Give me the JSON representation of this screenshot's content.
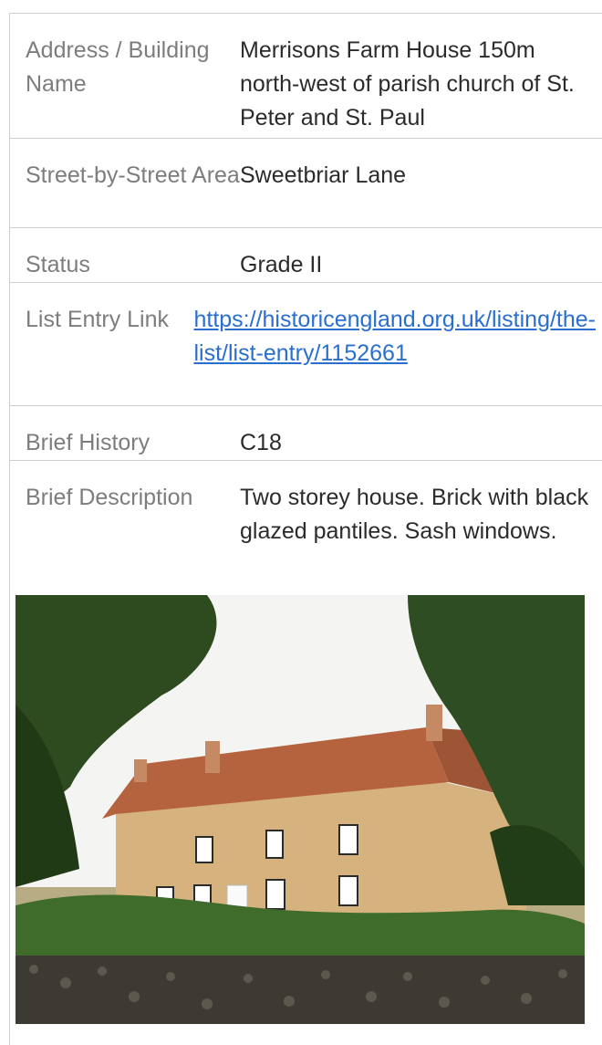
{
  "table": {
    "rows": [
      {
        "label": "Address / Building Name",
        "value": "Merrisons Farm House 150m north-west of parish church of St. Peter and St. Paul"
      },
      {
        "label": "Street-by-Street Area",
        "value": "Sweetbriar Lane"
      },
      {
        "label": "Status",
        "value": "Grade II"
      },
      {
        "label": "List Entry Link",
        "value": "https://historicengland.org.uk/listing/the-list/list-entry/1152661"
      },
      {
        "label": "Brief History",
        "value": "C18"
      },
      {
        "label": "Brief Description",
        "value": "Two storey house. Brick with black glazed pantiles. Sash windows."
      }
    ]
  },
  "photo": {
    "subject": "photo-farmhouse",
    "colors": {
      "sky": "#f4f4f2",
      "roof": "#b5633f",
      "wall": "#d6b27e",
      "foliage": "#2e4a1f",
      "flint_wall": "#3d3a33"
    }
  }
}
